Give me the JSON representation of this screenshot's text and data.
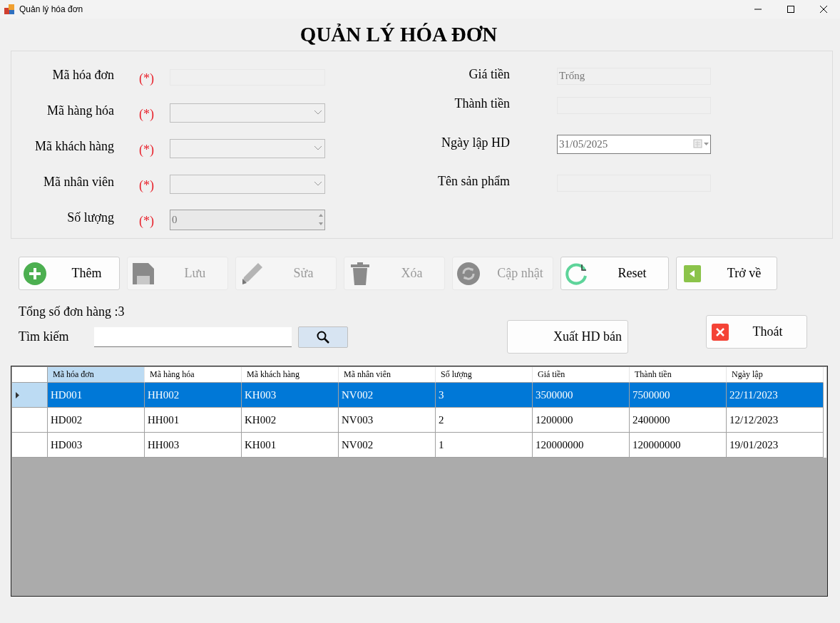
{
  "window": {
    "title": "Quản lý hóa đơn"
  },
  "heading": "QUẢN LÝ HÓA ĐƠN",
  "form_left": [
    {
      "label": "Mã hóa đơn",
      "required": "(*)",
      "kind": "text"
    },
    {
      "label": "Mã hàng hóa",
      "required": "(*)",
      "kind": "combo"
    },
    {
      "label": "Mã khách hàng",
      "required": "(*)",
      "kind": "combo"
    },
    {
      "label": "Mã nhân viên",
      "required": "(*)",
      "kind": "combo"
    },
    {
      "label": "Số lượng",
      "required": "(*)",
      "kind": "spin",
      "value": "0"
    }
  ],
  "form_right": [
    {
      "label": "Giá tiền",
      "kind": "text",
      "placeholder": "Trống"
    },
    {
      "label": "Thành tiền",
      "kind": "text"
    },
    {
      "label": "Ngày lập HD",
      "kind": "date",
      "value": "31/05/2025"
    },
    {
      "label": "Tên sản phẩm",
      "kind": "text"
    }
  ],
  "toolbar": [
    {
      "label": "Thêm",
      "kind": "add",
      "disabled": false
    },
    {
      "label": "Lưu",
      "kind": "save",
      "disabled": true
    },
    {
      "label": "Sửa",
      "kind": "edit",
      "disabled": true
    },
    {
      "label": "Xóa",
      "kind": "delete",
      "disabled": true
    },
    {
      "label": "Cập nhật",
      "kind": "update",
      "disabled": true
    },
    {
      "label": "Reset",
      "kind": "reset",
      "disabled": false
    },
    {
      "label": "Trở về",
      "kind": "back",
      "disabled": false
    }
  ],
  "total": "Tổng số đơn hàng :3",
  "search": {
    "label": "Tìm kiếm"
  },
  "export_button": "Xuất HD bán",
  "exit_button": "Thoát",
  "table": {
    "columns": [
      {
        "label": "Mã hóa đơn",
        "selected": true
      },
      {
        "label": "Mã hàng hóa",
        "selected": false
      },
      {
        "label": "Mã khách hàng",
        "selected": false
      },
      {
        "label": "Mã nhân viên",
        "selected": false
      },
      {
        "label": "Số lượng",
        "selected": false
      },
      {
        "label": "Giá tiền",
        "selected": false
      },
      {
        "label": "Thành tiền",
        "selected": false
      },
      {
        "label": "Ngày lập",
        "selected": false
      }
    ],
    "rows": [
      {
        "selected": true,
        "cells": [
          "HD001",
          "HH002",
          "KH003",
          "NV002",
          "3",
          "3500000",
          "7500000",
          "22/11/2023"
        ]
      },
      {
        "selected": false,
        "cells": [
          "HD002",
          "HH001",
          "KH002",
          "NV003",
          "2",
          "1200000",
          "2400000",
          "12/12/2023"
        ]
      },
      {
        "selected": false,
        "cells": [
          "HD003",
          "HH003",
          "KH001",
          "NV002",
          "1",
          "120000000",
          "120000000",
          "19/01/2023"
        ]
      }
    ]
  }
}
